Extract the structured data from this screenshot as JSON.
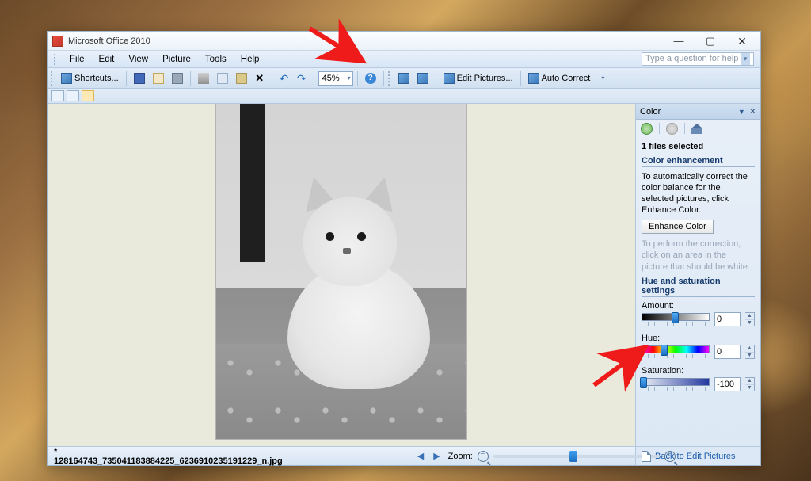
{
  "window": {
    "title": "Microsoft Office 2010"
  },
  "menubar": {
    "items": [
      "File",
      "Edit",
      "View",
      "Picture",
      "Tools",
      "Help"
    ],
    "help_placeholder": "Type a question for help"
  },
  "toolbar": {
    "shortcuts_label": "Shortcuts...",
    "zoom_value": "45%",
    "edit_pictures_label": "Edit Pictures...",
    "auto_correct_label": "Auto Correct"
  },
  "statusbar": {
    "filename": "* 128164743_735041183884225_6236910235191229_n.jpg",
    "zoom_label": "Zoom:"
  },
  "taskpane": {
    "title": "Color",
    "files_selected": "1 files selected",
    "section1_title": "Color enhancement",
    "section1_desc": "To automatically correct the color balance for the selected pictures, click Enhance Color.",
    "enhance_btn": "Enhance Color",
    "hint": "To perform the correction, click on an area in the picture that should be white.",
    "section2_title": "Hue and saturation settings",
    "sliders": {
      "amount": {
        "label": "Amount:",
        "value": "0",
        "pos": 50
      },
      "hue": {
        "label": "Hue:",
        "value": "0",
        "pos": 33
      },
      "saturation": {
        "label": "Saturation:",
        "value": "-100",
        "pos": 0
      }
    },
    "footer_link": "Back to Edit Pictures"
  }
}
